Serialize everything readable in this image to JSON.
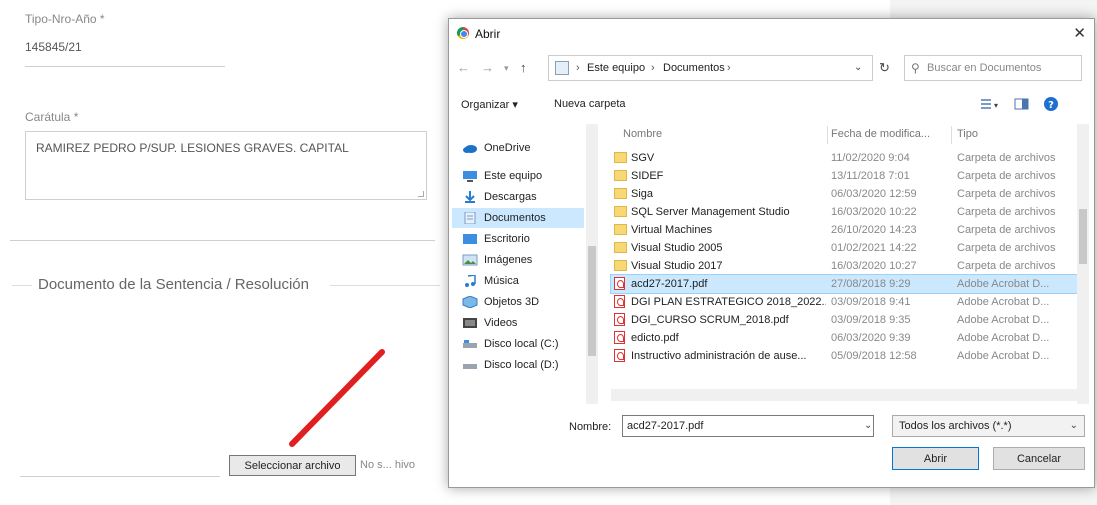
{
  "form": {
    "tipo_label": "Tipo-Nro-Año *",
    "tipo_value": "145845/21",
    "caratula_label": "Carátula *",
    "caratula_value": "RAMIREZ PEDRO P/SUP. LESIONES GRAVES. CAPITAL",
    "section_title": "Documento de la Sentencia / Resolución",
    "select_file_label": "Seleccionar archivo",
    "no_file_text": "No s... hivo"
  },
  "dialog": {
    "title": "Abrir",
    "close_glyph": "✕",
    "breadcrumbs": [
      "Este equipo",
      "Documentos"
    ],
    "search_placeholder": "Buscar en Documentos",
    "toolbar": {
      "organize": "Organizar ▾",
      "new_folder": "Nueva carpeta"
    },
    "nav_items": [
      {
        "label": "OneDrive",
        "icon": "onedrive-icon"
      },
      {
        "label": "Este equipo",
        "icon": "computer-icon"
      },
      {
        "label": "Descargas",
        "icon": "download-icon"
      },
      {
        "label": "Documentos",
        "icon": "documents-icon"
      },
      {
        "label": "Escritorio",
        "icon": "desktop-icon"
      },
      {
        "label": "Imágenes",
        "icon": "images-icon"
      },
      {
        "label": "Música",
        "icon": "music-icon"
      },
      {
        "label": "Objetos 3D",
        "icon": "objects3d-icon"
      },
      {
        "label": "Videos",
        "icon": "videos-icon"
      },
      {
        "label": "Disco local (C:)",
        "icon": "drive-icon"
      },
      {
        "label": "Disco local (D:)",
        "icon": "drive-icon"
      }
    ],
    "selected_nav": "Documentos",
    "columns": {
      "name": "Nombre",
      "date": "Fecha de modifica...",
      "type": "Tipo"
    },
    "files": [
      {
        "name": "SGV",
        "date": "11/02/2020 9:04",
        "type": "Carpeta de archivos",
        "kind": "folder"
      },
      {
        "name": "SIDEF",
        "date": "13/11/2018 7:01",
        "type": "Carpeta de archivos",
        "kind": "folder"
      },
      {
        "name": "Siga",
        "date": "06/03/2020 12:59",
        "type": "Carpeta de archivos",
        "kind": "folder"
      },
      {
        "name": "SQL Server Management Studio",
        "date": "16/03/2020 10:22",
        "type": "Carpeta de archivos",
        "kind": "folder"
      },
      {
        "name": "Virtual Machines",
        "date": "26/10/2020 14:23",
        "type": "Carpeta de archivos",
        "kind": "folder"
      },
      {
        "name": "Visual Studio 2005",
        "date": "01/02/2021 14:22",
        "type": "Carpeta de archivos",
        "kind": "folder"
      },
      {
        "name": "Visual Studio 2017",
        "date": "16/03/2020 10:27",
        "type": "Carpeta de archivos",
        "kind": "folder"
      },
      {
        "name": "acd27-2017.pdf",
        "date": "27/08/2018 9:29",
        "type": "Adobe Acrobat D...",
        "kind": "pdf",
        "selected": true
      },
      {
        "name": "DGI PLAN ESTRATEGICO 2018_2022...",
        "date": "03/09/2018 9:41",
        "type": "Adobe Acrobat D...",
        "kind": "pdf"
      },
      {
        "name": "DGI_CURSO SCRUM_2018.pdf",
        "date": "03/09/2018 9:35",
        "type": "Adobe Acrobat D...",
        "kind": "pdf"
      },
      {
        "name": "edicto.pdf",
        "date": "06/03/2020 9:39",
        "type": "Adobe Acrobat D...",
        "kind": "pdf"
      },
      {
        "name": "Instructivo administración de ause...",
        "date": "05/09/2018 12:58",
        "type": "Adobe Acrobat D...",
        "kind": "pdf"
      }
    ],
    "filename_label": "Nombre:",
    "filename_value": "acd27-2017.pdf",
    "filter_value": "Todos los archivos (*.*)",
    "open_label": "Abrir",
    "cancel_label": "Cancelar"
  },
  "colors": {
    "accent": "#0078d7",
    "selection": "#cce8ff",
    "arrow": "#e02020",
    "folder": "#f8d775"
  }
}
